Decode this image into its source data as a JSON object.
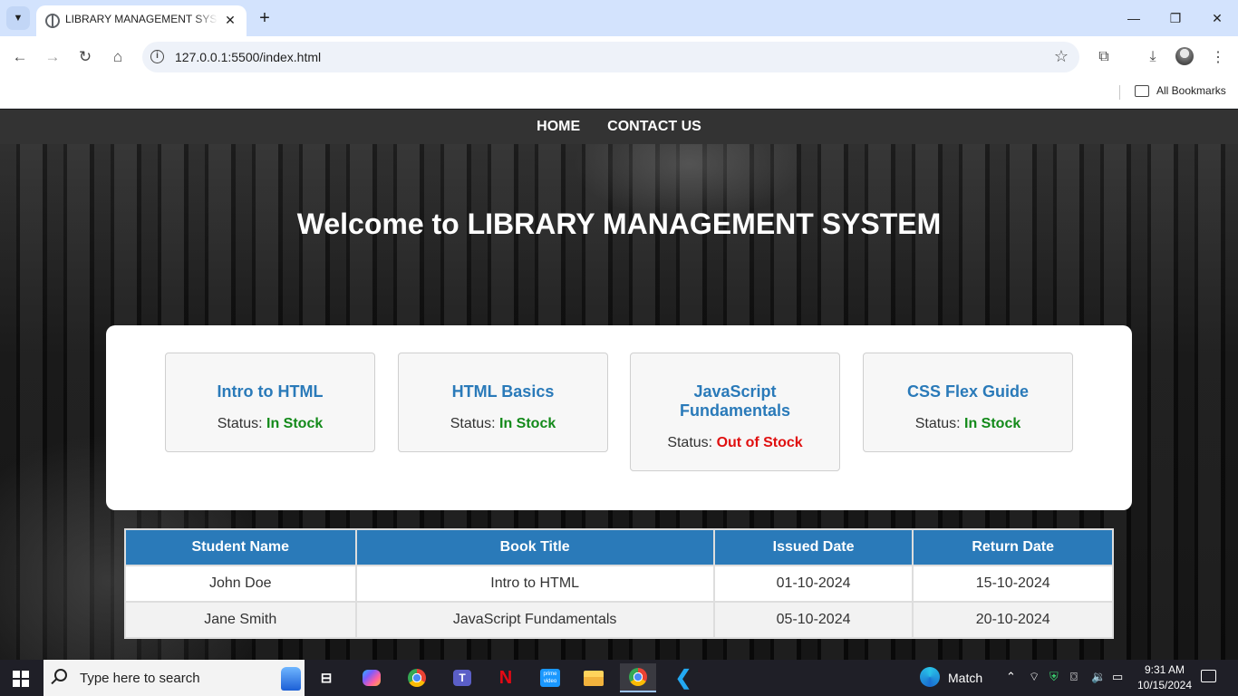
{
  "browser": {
    "tab_title": "LIBRARY MANAGEMENT SYSTEM",
    "url": "127.0.0.1:5500/index.html",
    "bookmarks_label": "All Bookmarks"
  },
  "page": {
    "nav": {
      "home": "HOME",
      "contact": "CONTACT US"
    },
    "heading": "Welcome to LIBRARY MANAGEMENT SYSTEM",
    "status_label": "Status:",
    "books": [
      {
        "title": "Intro to HTML",
        "status": "In Stock"
      },
      {
        "title": "HTML Basics",
        "status": "In Stock"
      },
      {
        "title": "JavaScript Fundamentals",
        "status": "Out of Stock"
      },
      {
        "title": "CSS Flex Guide",
        "status": "In Stock"
      }
    ],
    "table": {
      "headers": [
        "Student Name",
        "Book Title",
        "Issued Date",
        "Return Date"
      ],
      "rows": [
        [
          "John Doe",
          "Intro to HTML",
          "01-10-2024",
          "15-10-2024"
        ],
        [
          "Jane Smith",
          "JavaScript Fundamentals",
          "05-10-2024",
          "20-10-2024"
        ]
      ]
    },
    "colors": {
      "accent": "#2a7ab9",
      "in_stock": "#138a1a",
      "out_of_stock": "#e01010",
      "navbar": "#333333"
    }
  },
  "taskbar": {
    "search_placeholder": "Type here to search",
    "weather_label": "Match",
    "time": "9:31 AM",
    "date": "10/15/2024",
    "apps": [
      "task-view",
      "copilot",
      "chrome",
      "teams",
      "netflix",
      "prime-video",
      "file-explorer",
      "chrome-profile",
      "vscode"
    ]
  }
}
